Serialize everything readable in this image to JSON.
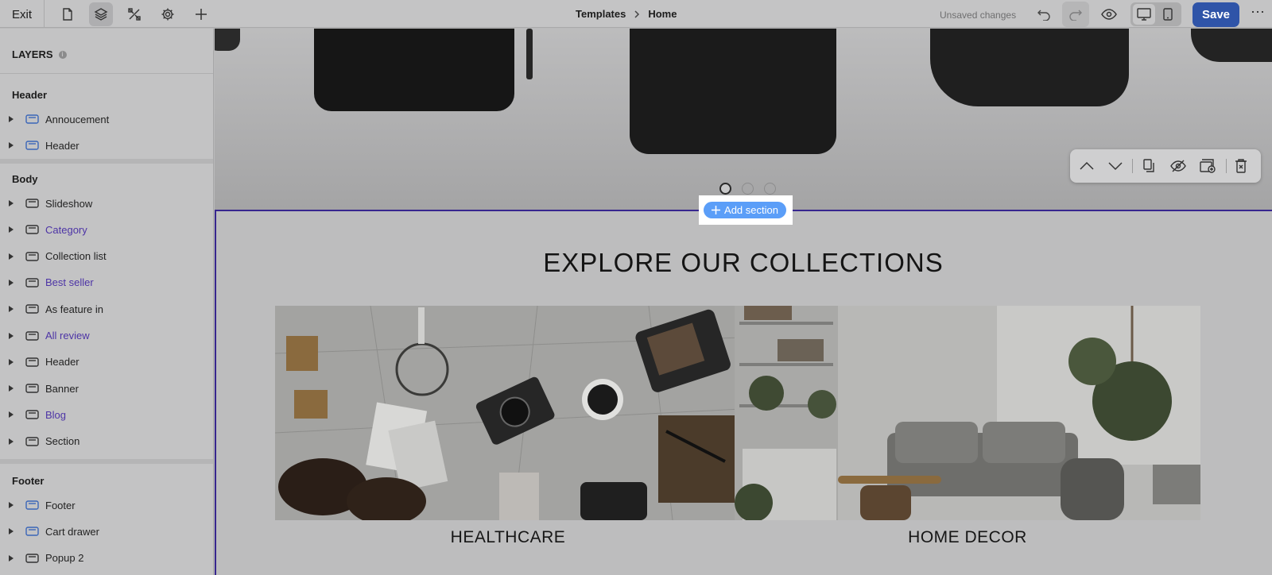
{
  "topbar": {
    "exit_label": "Exit",
    "icons": [
      "pages-icon",
      "layers-icon",
      "customize-icon",
      "settings-icon",
      "add-icon"
    ],
    "breadcrumb": {
      "parent": "Templates",
      "current": "Home"
    },
    "status": "Unsaved changes",
    "save_label": "Save"
  },
  "sidebar": {
    "title": "LAYERS",
    "groups": [
      {
        "title": "Header",
        "items": [
          {
            "label": "Annoucement",
            "highlight": false
          },
          {
            "label": "Header",
            "highlight": false
          }
        ]
      },
      {
        "title": "Body",
        "items": [
          {
            "label": "Slideshow",
            "highlight": false
          },
          {
            "label": "Category",
            "highlight": true
          },
          {
            "label": "Collection list",
            "highlight": false
          },
          {
            "label": "Best seller",
            "highlight": true
          },
          {
            "label": "As feature in",
            "highlight": false
          },
          {
            "label": "All review",
            "highlight": true
          },
          {
            "label": "Header",
            "highlight": false
          },
          {
            "label": "Banner",
            "highlight": false
          },
          {
            "label": "Blog",
            "highlight": true
          },
          {
            "label": "Section",
            "highlight": false
          }
        ]
      },
      {
        "title": "Footer",
        "items": [
          {
            "label": "Footer",
            "highlight": false
          },
          {
            "label": "Cart drawer",
            "highlight": false
          },
          {
            "label": "Popup 2",
            "highlight": false
          }
        ]
      }
    ]
  },
  "canvas": {
    "slideshow": {
      "slides": 3,
      "active_slide": 1
    },
    "add_section_label": "Add section",
    "section_title": "EXPLORE OUR COLLECTIONS",
    "collections": [
      {
        "label": "HEALTHCARE"
      },
      {
        "label": "HOME DECOR"
      }
    ],
    "section_tools": [
      "move-up-icon",
      "move-down-icon",
      "duplicate-icon",
      "hide-icon",
      "add-block-icon",
      "delete-icon"
    ]
  },
  "colors": {
    "accent": "#2f54a8",
    "selection": "#37268e",
    "add_button": "#5b9ef8",
    "highlight_text": "#4d34a6"
  }
}
